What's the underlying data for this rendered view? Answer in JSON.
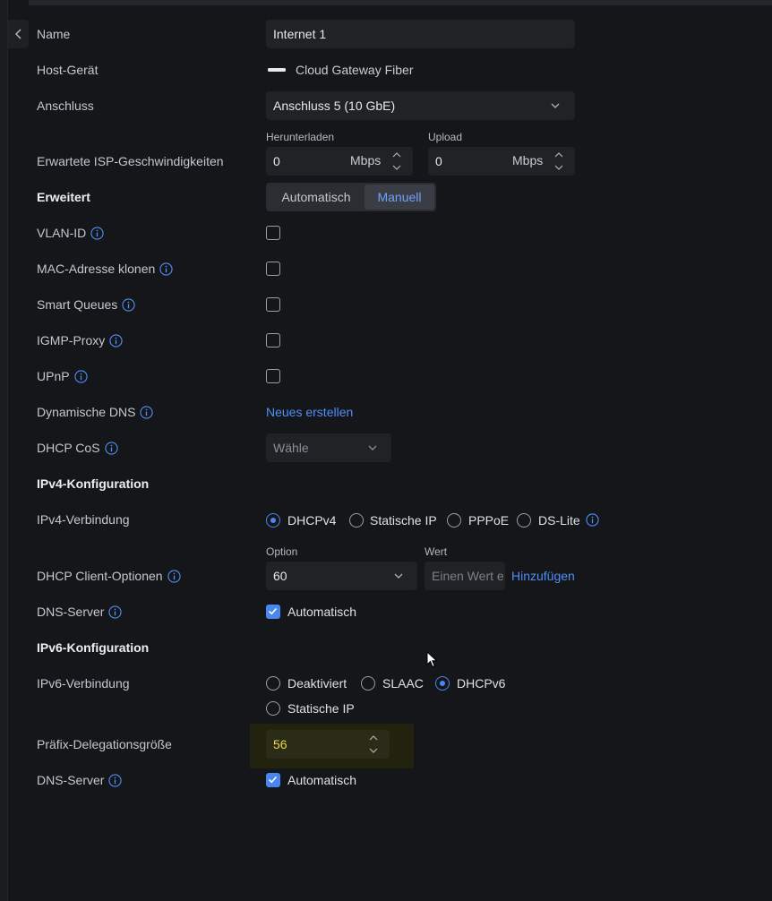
{
  "fields": {
    "name": {
      "label": "Name",
      "value": "Internet 1"
    },
    "host": {
      "label": "Host-Gerät",
      "value": "Cloud Gateway Fiber"
    },
    "port": {
      "label": "Anschluss",
      "value": "Anschluss 5 (10 GbE)"
    },
    "isp": {
      "label": "Erwartete ISP-Geschwindigkeiten",
      "download_label": "Herunterladen",
      "download_value": "0",
      "upload_label": "Upload",
      "upload_value": "0",
      "unit": "Mbps"
    }
  },
  "advanced": {
    "label": "Erweitert",
    "options": [
      "Automatisch",
      "Manuell"
    ],
    "selected": "Manuell"
  },
  "toggles": {
    "vlan": {
      "label": "VLAN-ID",
      "checked": false
    },
    "mac_clone": {
      "label": "MAC-Adresse klonen",
      "checked": false
    },
    "smart_queues": {
      "label": "Smart Queues",
      "checked": false
    },
    "igmp": {
      "label": "IGMP-Proxy",
      "checked": false
    },
    "upnp": {
      "label": "UPnP",
      "checked": false
    }
  },
  "dyndns": {
    "label": "Dynamische DNS",
    "link": "Neues erstellen"
  },
  "dhcp_cos": {
    "label": "DHCP CoS",
    "placeholder": "Wähle"
  },
  "ipv4": {
    "section_title": "IPv4-Konfiguration",
    "connection_label": "IPv4-Verbindung",
    "options": [
      "DHCPv4",
      "Statische IP",
      "PPPoE",
      "DS-Lite"
    ],
    "selected": "DHCPv4",
    "client_options_label": "DHCP Client-Optionen",
    "option_label": "Option",
    "option_value": "60",
    "value_label": "Wert",
    "value_placeholder": "Einen Wert e",
    "add_link": "Hinzufügen",
    "dns_label": "DNS-Server",
    "dns_auto_label": "Automatisch",
    "dns_auto": true
  },
  "ipv6": {
    "section_title": "IPv6-Konfiguration",
    "connection_label": "IPv6-Verbindung",
    "options": [
      "Deaktiviert",
      "SLAAC",
      "DHCPv6",
      "Statische IP"
    ],
    "selected": "DHCPv6",
    "prefix_label": "Präfix-Delegationsgröße",
    "prefix_value": "56",
    "dns_label": "DNS-Server",
    "dns_auto_label": "Automatisch",
    "dns_auto": true
  },
  "colors": {
    "background": "#151619",
    "accent": "#4a86f0",
    "highlight_text": "#e8d84a"
  }
}
